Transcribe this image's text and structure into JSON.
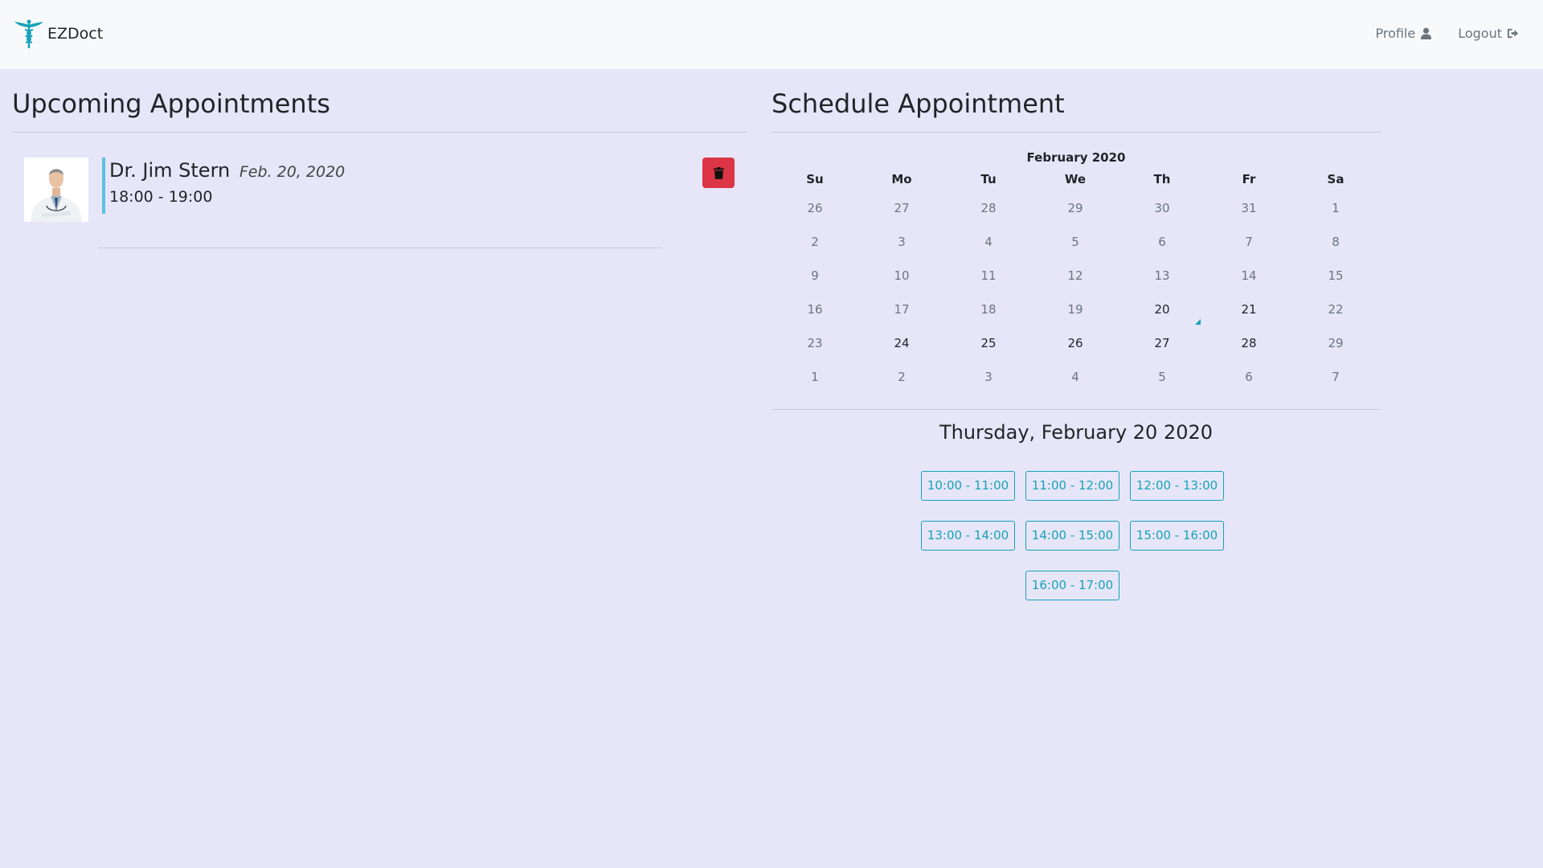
{
  "navbar": {
    "brand": "EZDoct",
    "links": [
      {
        "label": "Profile",
        "icon": "user-icon"
      },
      {
        "label": "Logout",
        "icon": "sign-out-icon"
      }
    ]
  },
  "upcoming": {
    "title": "Upcoming Appointments",
    "appointments": [
      {
        "doctor": "Dr. Jim Stern",
        "date": "Feb. 20, 2020",
        "time": "18:00 - 19:00",
        "photo": "doctor-photo"
      }
    ],
    "delete_icon": "trash-icon"
  },
  "schedule": {
    "title": "Schedule Appointment",
    "calendar": {
      "month": "February 2020",
      "weekdays": [
        "Su",
        "Mo",
        "Tu",
        "We",
        "Th",
        "Fr",
        "Sa"
      ],
      "weeks": [
        [
          "26",
          "27",
          "28",
          "29",
          "30",
          "31",
          "1"
        ],
        [
          "2",
          "3",
          "4",
          "5",
          "6",
          "7",
          "8"
        ],
        [
          "9",
          "10",
          "11",
          "12",
          "13",
          "14",
          "15"
        ],
        [
          "16",
          "17",
          "18",
          "19",
          "20",
          "21",
          "22"
        ],
        [
          "23",
          "24",
          "25",
          "26",
          "27",
          "28",
          "29"
        ],
        [
          "1",
          "2",
          "3",
          "4",
          "5",
          "6",
          "7"
        ]
      ],
      "selected": "20"
    },
    "selected_date": "Thursday, February 20 2020",
    "slots": [
      "10:00 - 11:00",
      "11:00 - 12:00",
      "12:00 - 13:00",
      "13:00 - 14:00",
      "14:00 - 15:00",
      "15:00 - 16:00",
      "16:00 - 17:00"
    ],
    "colors": {
      "accent": "#17a2b8",
      "danger": "#dc3545",
      "background": "#e6e6f8"
    }
  }
}
